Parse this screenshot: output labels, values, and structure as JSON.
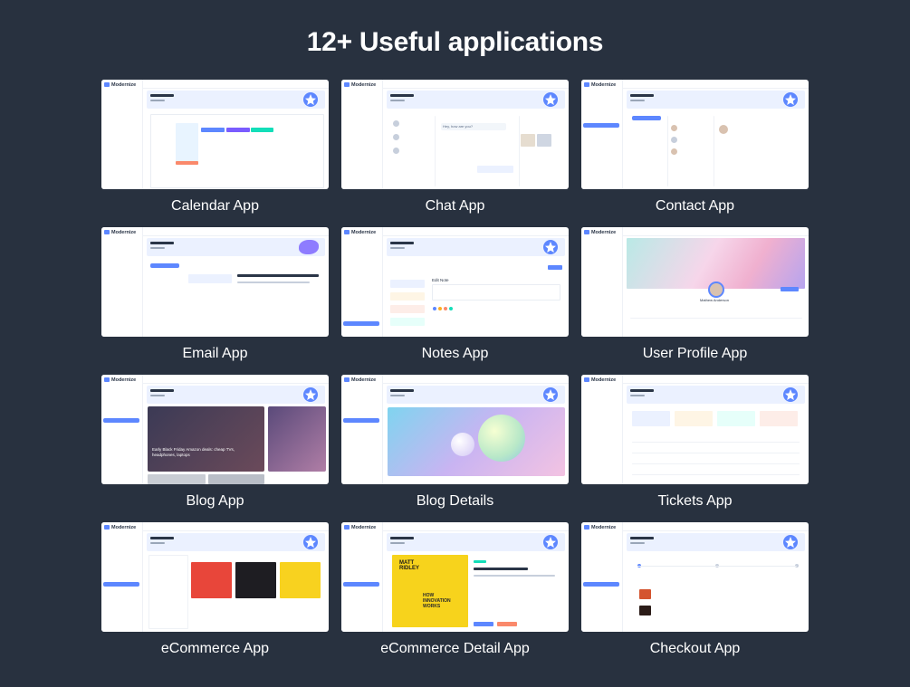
{
  "heading": "12+ Useful applications",
  "brand": "Modernize",
  "colors": {
    "background": "#28313f",
    "primary": "#5d87ff",
    "banner": "#ebf1ff",
    "text": "#ffffff"
  },
  "apps": [
    {
      "id": "calendar",
      "caption": "Calendar App"
    },
    {
      "id": "chat",
      "caption": "Chat App"
    },
    {
      "id": "contact",
      "caption": "Contact App"
    },
    {
      "id": "email",
      "caption": "Email App"
    },
    {
      "id": "notes",
      "caption": "Notes App"
    },
    {
      "id": "profile",
      "caption": "User Profile App"
    },
    {
      "id": "blog",
      "caption": "Blog App"
    },
    {
      "id": "blog-details",
      "caption": "Blog Details"
    },
    {
      "id": "tickets",
      "caption": "Tickets App"
    },
    {
      "id": "ecommerce",
      "caption": "eCommerce App"
    },
    {
      "id": "ecommerce-detail",
      "caption": "eCommerce Detail App"
    },
    {
      "id": "checkout",
      "caption": "Checkout App"
    }
  ],
  "shots": {
    "chat": {
      "bubble": "Hey, how are you?"
    },
    "notes": {
      "heading": "Edit Note"
    },
    "profile": {
      "name": "Mathew Anderson"
    },
    "blog": {
      "headline": "Early Black Friday Amazon deals: cheap TVs, headphones, laptops"
    },
    "ecommerce_detail": {
      "book_line1": "MATT",
      "book_line2": "RIDLEY",
      "book_line3": "HOW INNOVATION WORKS"
    }
  }
}
